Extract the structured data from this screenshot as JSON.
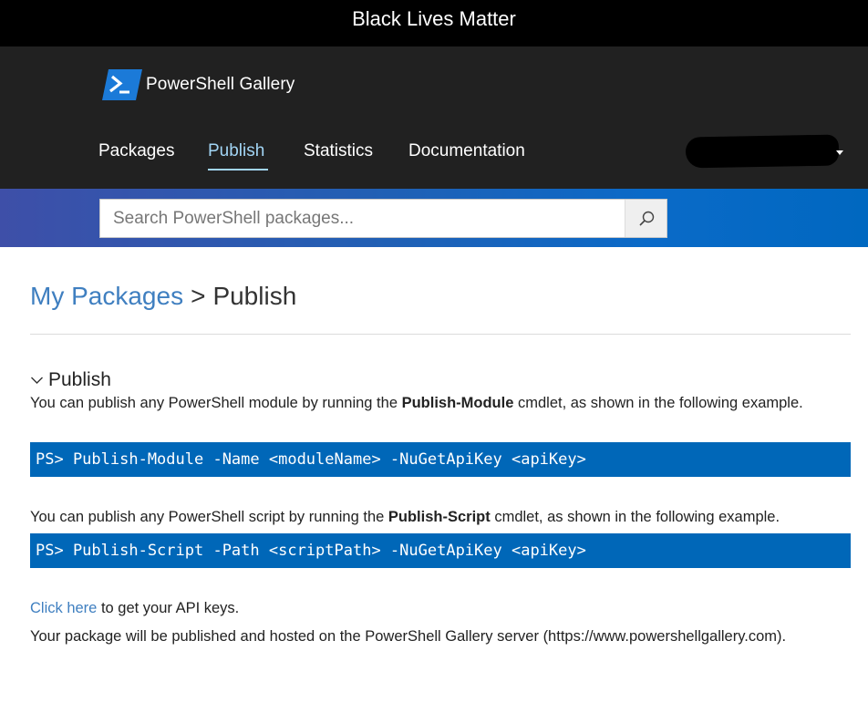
{
  "banner": {
    "text": "Black Lives Matter"
  },
  "header": {
    "logo_text": "PowerShell Gallery",
    "nav": [
      {
        "label": "Packages",
        "active": false
      },
      {
        "label": "Publish",
        "active": true
      },
      {
        "label": "Statistics",
        "active": false
      },
      {
        "label": "Documentation",
        "active": false
      }
    ]
  },
  "search": {
    "placeholder": "Search PowerShell packages..."
  },
  "breadcrumb": {
    "parent": "My Packages",
    "separator": ">",
    "current": "Publish"
  },
  "section": {
    "title": "Publish",
    "module_text_before": "You can publish any PowerShell module by running the ",
    "module_cmdlet": "Publish-Module",
    "module_text_after": " cmdlet, as shown in the following example.",
    "module_code": "PS> Publish-Module -Name <moduleName> -NuGetApiKey <apiKey>",
    "script_text_before": "You can publish any PowerShell script by running the ",
    "script_cmdlet": "Publish-Script",
    "script_text_after": " cmdlet, as shown in the following example.",
    "script_code": "PS> Publish-Script -Path <scriptPath> -NuGetApiKey <apiKey>",
    "api_link": "Click here",
    "api_text": " to get your API keys.",
    "hosted_text": "Your package will be published and hosted on the PowerShell Gallery server (https://www.powershellgallery.com)."
  },
  "colors": {
    "accent": "#0067b8",
    "link": "#3f7fc0",
    "header_bg": "#212121",
    "nav_active": "#a2d5f5"
  }
}
